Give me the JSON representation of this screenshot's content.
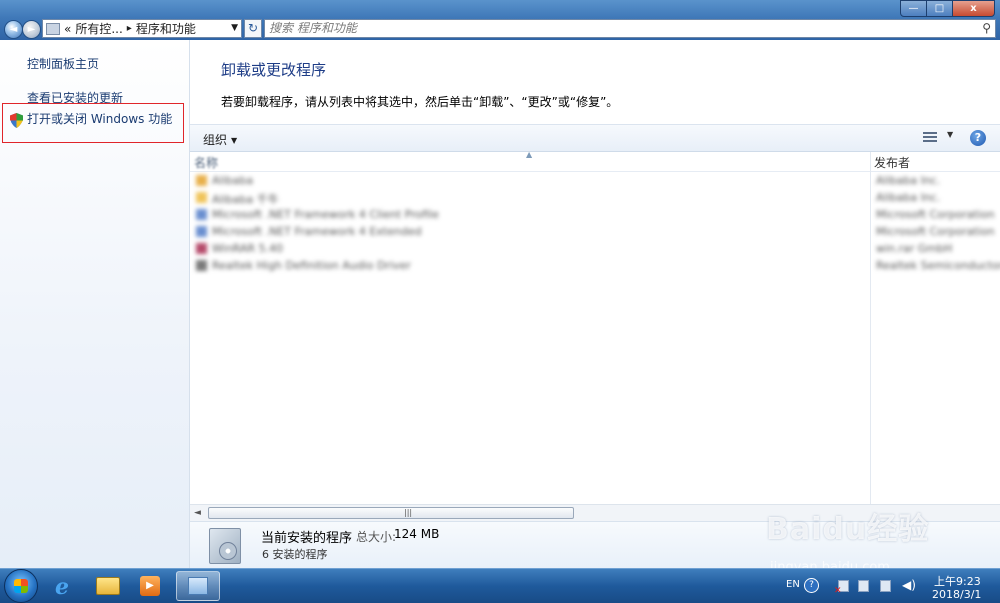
{
  "window": {
    "breadcrumb": [
      "«",
      "所有控...",
      "程序和功能"
    ],
    "search_placeholder": "搜索 程序和功能",
    "controls": {
      "minimize": "—",
      "maximize": "□",
      "close": "x"
    }
  },
  "sidebar": {
    "home": "控制面板主页",
    "updates": "查看已安装的更新",
    "features": "打开或关闭 Windows 功能"
  },
  "main": {
    "heading": "卸载或更改程序",
    "instruction": "若要卸载程序，请从列表中将其选中，然后单击“卸载”、“更改”或“修复”。",
    "organize": "组织",
    "columns": {
      "name": "名称",
      "publisher": "发布者"
    },
    "rows": [
      {
        "name": "Alibaba",
        "publisher": "Alibaba Inc.",
        "color": "#e8b04a"
      },
      {
        "name": "Alibaba 千牛",
        "publisher": "Alibaba Inc.",
        "color": "#f0c45a"
      },
      {
        "name": "Microsoft .NET Framework 4 Client Profile",
        "publisher": "Microsoft Corporation",
        "color": "#6a8fd0"
      },
      {
        "name": "Microsoft .NET Framework 4 Extended",
        "publisher": "Microsoft Corporation",
        "color": "#6a8fd0"
      },
      {
        "name": "WinRAR 5.40",
        "publisher": "win.rar GmbH",
        "color": "#b54a6a"
      },
      {
        "name": "Realtek High Definition Audio Driver",
        "publisher": "Realtek Semiconductor Corp.",
        "color": "#7a7a7a"
      }
    ]
  },
  "details": {
    "title": "当前安装的程序",
    "size_label": "总大小:",
    "size": "124 MB",
    "count": "6 安装的程序"
  },
  "taskbar": {
    "lang": "EN",
    "time": "上午9:23",
    "date": "2018/3/1"
  },
  "watermark": {
    "text": "Baidu经验",
    "url": "jingyan.baidu.com"
  }
}
